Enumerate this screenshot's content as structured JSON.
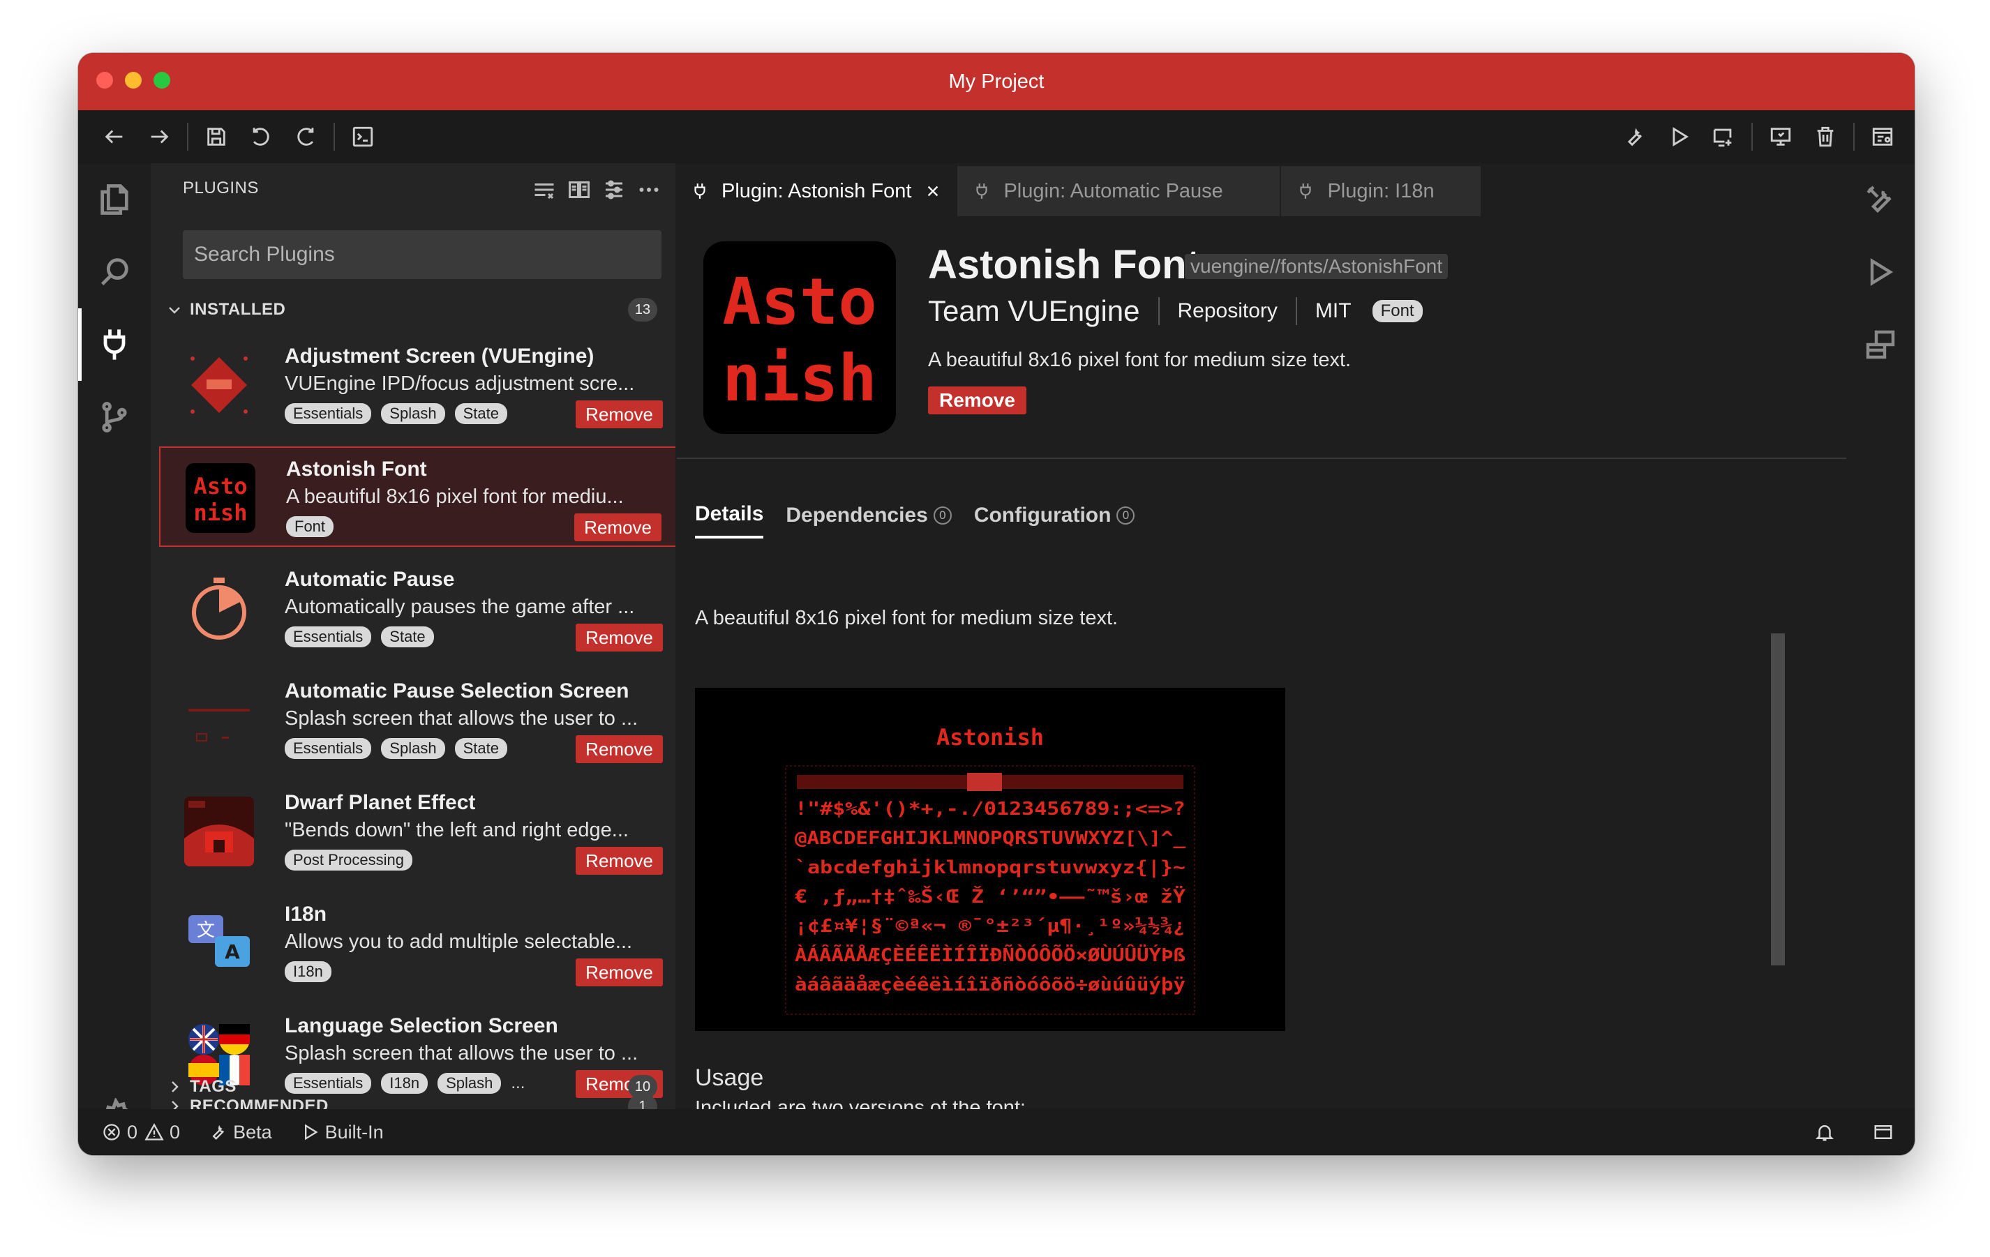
{
  "window": {
    "title": "My Project"
  },
  "colors": {
    "accent": "#c4302b",
    "background": "#1e1e1e",
    "sidebar": "#252526",
    "tag": "#d9d9d9"
  },
  "toolbar": {
    "left_icons": [
      "arrow-left-icon",
      "arrow-right-icon",
      "save-icon",
      "undo-icon",
      "redo-icon",
      "terminal-icon"
    ],
    "right_icons": [
      "wrench-icon",
      "play-icon",
      "add-screen-icon",
      "emulator-icon",
      "trash-icon",
      "settings-panel-icon"
    ]
  },
  "activity_bar": [
    "files-icon",
    "search-icon",
    "plug-icon",
    "source-control-icon",
    "gear-icon"
  ],
  "sidebar": {
    "header": "PLUGINS",
    "search_placeholder": "Search Plugins",
    "installed": {
      "label": "INSTALLED",
      "count": "13"
    },
    "tags_section": {
      "label": "TAGS",
      "count": "10"
    },
    "recommended": {
      "label": "RECOMMENDED",
      "count": "1"
    },
    "remove_label": "Remove",
    "plugins": [
      {
        "name": "Adjustment Screen (VUEngine)",
        "desc": "VUEngine IPD/focus adjustment scre...",
        "tags": [
          "Essentials",
          "Splash",
          "State"
        ],
        "more": "",
        "thumb": "adjustment"
      },
      {
        "name": "Astonish Font",
        "desc": "A beautiful 8x16 pixel font for mediu...",
        "tags": [
          "Font"
        ],
        "more": "",
        "thumb": "astonish"
      },
      {
        "name": "Automatic Pause",
        "desc": "Automatically pauses the game after ...",
        "tags": [
          "Essentials",
          "State"
        ],
        "more": "",
        "thumb": "timer"
      },
      {
        "name": "Automatic Pause Selection Screen",
        "desc": "Splash screen that allows the user to ...",
        "tags": [
          "Essentials",
          "Splash",
          "State"
        ],
        "more": "",
        "thumb": "pause-screen"
      },
      {
        "name": "Dwarf Planet Effect",
        "desc": "\"Bends down\" the left and right edge...",
        "tags": [
          "Post Processing"
        ],
        "more": "",
        "thumb": "dwarf"
      },
      {
        "name": "I18n",
        "desc": "Allows you to add multiple selectable...",
        "tags": [
          "I18n"
        ],
        "more": "",
        "thumb": "i18n"
      },
      {
        "name": "Language Selection Screen",
        "desc": "Splash screen that allows the user to ...",
        "tags": [
          "Essentials",
          "I18n",
          "Splash"
        ],
        "more": "...",
        "thumb": "flags"
      }
    ]
  },
  "tabs": [
    {
      "label": "Plugin: Astonish Font",
      "active": true
    },
    {
      "label": "Plugin: Automatic Pause",
      "active": false
    },
    {
      "label": "Plugin: I18n",
      "active": false
    }
  ],
  "plugin_detail": {
    "logo_text": [
      "Asto",
      "nish"
    ],
    "name": "Astonish Font",
    "id": "vuengine//fonts/AstonishFont",
    "author": "Team VUEngine",
    "repository": "Repository",
    "license": "MIT",
    "tag": "Font",
    "description": "A beautiful 8x16 pixel font for medium size text.",
    "remove_label": "Remove",
    "detail_tabs": [
      {
        "label": "Details",
        "badge": ""
      },
      {
        "label": "Dependencies",
        "badge": "0"
      },
      {
        "label": "Configuration",
        "badge": "0"
      }
    ],
    "content_text": "A beautiful 8x16 pixel font for medium size text.",
    "preview": {
      "title": "Astonish",
      "rows": [
        "!\"#$%&'()*+,-./0123456789:;<=>?",
        "@ABCDEFGHIJKLMNOPQRSTUVWXYZ[\\]^_",
        "`abcdefghijklmnopqrstuvwxyz{|}~",
        "€ ‚ƒ„…†‡ˆ‰Š‹Œ Ž  ‘’“”•–—˜™š›œ žŸ",
        "¡¢£¤¥¦§¨©ª«¬ ®¯°±²³´µ¶·¸¹º»¼½¾¿",
        "ÀÁÂÃÄÅÆÇÈÉÊËÌÍÎÏÐÑÒÓÔÕÖ×ØÙÚÛÜÝÞß",
        "àáâãäåæçèéêëìíîïðñòóôõö÷øùúûüýþÿ"
      ]
    },
    "usage_heading": "Usage",
    "usage_text": "Included are two versions of the font:"
  },
  "right_bar": [
    "tools-icon",
    "run-icon",
    "layers-icon"
  ],
  "status": {
    "errors": "0",
    "warnings": "0",
    "beta": "Beta",
    "builtin": "Built-In"
  }
}
